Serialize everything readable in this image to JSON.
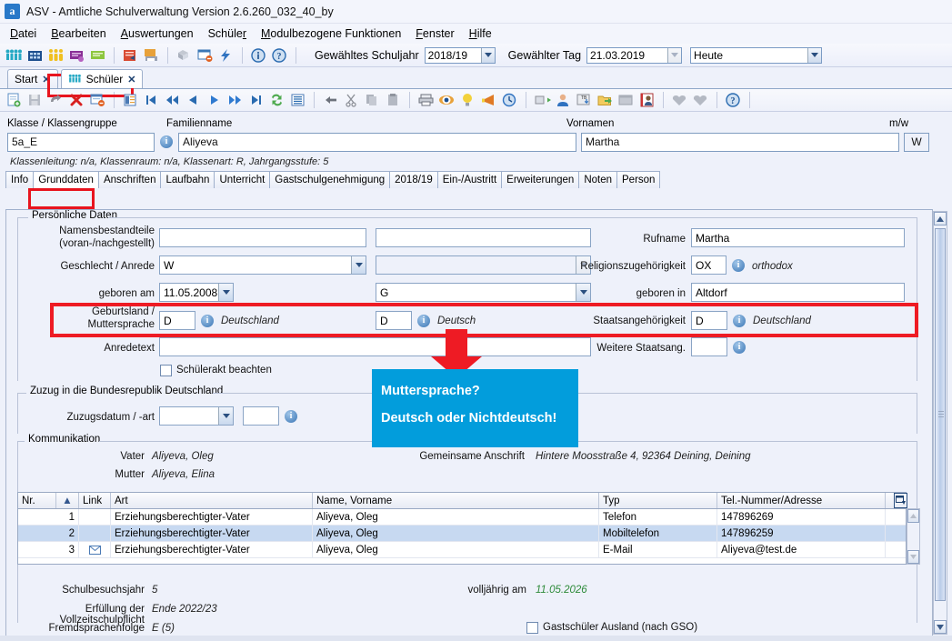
{
  "window": {
    "title": "ASV - Amtliche Schulverwaltung Version 2.6.260_032_40_by",
    "app_icon": "a"
  },
  "menubar": {
    "items": [
      {
        "label": "Datei",
        "mnemonic": "D"
      },
      {
        "label": "Bearbeiten",
        "mnemonic": "B"
      },
      {
        "label": "Auswertungen",
        "mnemonic": "A"
      },
      {
        "label": "Schüler",
        "mnemonic": "r"
      },
      {
        "label": "Modulbezogene Funktionen",
        "mnemonic": "M"
      },
      {
        "label": "Fenster",
        "mnemonic": "F"
      },
      {
        "label": "Hilfe",
        "mnemonic": "H"
      }
    ]
  },
  "toolbar_main": {
    "icons": [
      "students-group-icon",
      "school-building-icon",
      "persons-icon",
      "purple-card-icon",
      "green-card-icon",
      "report-book-icon",
      "print-list-icon",
      "module-grey-icon",
      "window-block-icon",
      "lightning-icon",
      "info-icon",
      "help-icon"
    ],
    "schoolyear_label": "Gewähltes Schuljahr",
    "schoolyear_value": "2018/19",
    "day_label": "Gewählter Tag",
    "day_value": "21.03.2019",
    "today_value": "Heute"
  },
  "window_tabs": [
    {
      "label": "Start",
      "icon": "",
      "active": false,
      "closable": true
    },
    {
      "label": "Schüler",
      "icon": "students-group-icon",
      "active": true,
      "closable": true,
      "highlighted": true
    }
  ],
  "toolbar_edit": {
    "icons": [
      "new-document-icon",
      "save-icon",
      "undo-icon",
      "delete-red-x-icon",
      "form-remove-icon",
      "list-view-icon",
      "first-record-icon",
      "prev-page-icon",
      "prev-record-icon",
      "next-record-icon",
      "next-page-icon",
      "last-record-icon",
      "refresh-icon",
      "report-icon",
      "back-arrow-icon",
      "cut-icon",
      "copy-icon",
      "paste-icon",
      "print-icon",
      "preview-eye-icon",
      "bulb-icon",
      "trumpet-icon",
      "clock-icon",
      "export-box-icon",
      "person-blue-icon",
      "tb-table-icon",
      "folder-export-icon",
      "grey-window-icon",
      "photo-person-icon",
      "grey-heart-left-icon",
      "grey-heart-right-icon",
      "help-blue-icon"
    ]
  },
  "header": {
    "klasse_label": "Klasse / Klassengruppe",
    "klasse_value": "5a_E",
    "familienname_label": "Familienname",
    "familienname_value": "Aliyeva",
    "vornamen_label": "Vornamen",
    "vornamen_value": "Martha",
    "mw_label": "m/w",
    "mw_value": "W",
    "info_line": "Klassenleitung: n/a, Klassenraum: n/a, Klassenart: R, Jahrgangsstufe: 5"
  },
  "content_tabs": [
    {
      "label": "Info",
      "active": false
    },
    {
      "label": "Grunddaten",
      "active": true,
      "highlighted": true
    },
    {
      "label": "Anschriften",
      "active": false
    },
    {
      "label": "Laufbahn",
      "active": false
    },
    {
      "label": "Unterricht",
      "active": false
    },
    {
      "label": "Gastschulgenehmigung",
      "active": false
    },
    {
      "label": "2018/19",
      "active": false
    },
    {
      "label": "Ein-/Austritt",
      "active": false
    },
    {
      "label": "Erweiterungen",
      "active": false
    },
    {
      "label": "Noten",
      "active": false
    },
    {
      "label": "Person",
      "active": false
    }
  ],
  "personal_group": {
    "title": "Persönliche Daten",
    "namensbestandteile_label": "Namensbestandteile\n(voran-/nachgestellt)",
    "namensbestandteile_label_1": "Namensbestandteile",
    "namensbestandteile_label_2": "(voran-/nachgestellt)",
    "namensbestandteile_value_1": "",
    "namensbestandteile_value_2": "",
    "geschlecht_label": "Geschlecht / Anrede",
    "geschlecht_value": "W",
    "anrede_value": "",
    "geboren_am_label": "geboren am",
    "geboren_am_value": "11.05.2008",
    "geburtsart_value": "G",
    "geburtsland_label_1": "Geburtsland /",
    "geburtsland_label_2": "Muttersprache",
    "geburtsland_value": "D",
    "geburtsland_text": "Deutschland",
    "muttersprache_value": "D",
    "muttersprache_text": "Deutsch",
    "anredetext_label": "Anredetext",
    "anredetext_value": "",
    "schuelerakt_label": "Schülerakt beachten",
    "rufname_label": "Rufname",
    "rufname_value": "Martha",
    "religion_label": "Religionszugehörigkeit",
    "religion_value": "OX",
    "religion_text": "orthodox",
    "geboren_in_label": "geboren in",
    "geboren_in_value": "Altdorf",
    "staatsang_label": "Staatsangehörigkeit",
    "staatsang_value": "D",
    "staatsang_text": "Deutschland",
    "weitere_staatsang_label": "Weitere Staatsang.",
    "weitere_staatsang_value": ""
  },
  "zuzug_group": {
    "title": "Zuzug in die Bundesrepublik Deutschland",
    "zuzugsdatum_label": "Zuzugsdatum / -art",
    "zuzugsdatum_value": "",
    "zuzugsart_value": ""
  },
  "kommunikation_group": {
    "title": "Kommunikation",
    "vater_label": "Vater",
    "vater_value": "Aliyeva, Oleg",
    "mutter_label": "Mutter",
    "mutter_value": "Aliyeva, Elina",
    "anschrift_label": "Gemeinsame Anschrift",
    "anschrift_value": "Hintere Moosstraße 4, 92364 Deining, Deining"
  },
  "contacts_table": {
    "columns": [
      "Nr.",
      "Link",
      "Art",
      "Name, Vorname",
      "Typ",
      "Tel.-Nummer/Adresse"
    ],
    "sort_indicator": "▲",
    "rows": [
      {
        "nr": "1",
        "link": "",
        "art": "Erziehungsberechtigter-Vater",
        "name": "Aliyeva, Oleg",
        "typ": "Telefon",
        "tel": "147896269",
        "selected": false
      },
      {
        "nr": "2",
        "link": "",
        "art": "Erziehungsberechtigter-Vater",
        "name": "Aliyeva, Oleg",
        "typ": "Mobiltelefon",
        "tel": "147896259",
        "selected": true
      },
      {
        "nr": "3",
        "link": "mail-icon",
        "art": "Erziehungsberechtigter-Vater",
        "name": "Aliyeva, Oleg",
        "typ": "E-Mail",
        "tel": "Aliyeva@test.de",
        "selected": false
      }
    ],
    "column_chooser_icon": "column-settings-icon"
  },
  "footer": {
    "schulbesuchsjahr_label": "Schulbesuchsjahr",
    "schulbesuchsjahr_value": "5",
    "volljaehrig_label": "volljährig am",
    "volljaehrig_value": "11.05.2026",
    "vollzeit_label": "Erfüllung der Vollzeitschulpflicht",
    "vollzeit_value": "Ende 2022/23",
    "fremdsprachen_label": "Fremdsprachenfolge",
    "fremdsprachen_value": "E (5)",
    "gastschueler_label": "Gastschüler Ausland (nach GSO)"
  },
  "annotation": {
    "line1": "Muttersprache?",
    "line2": "Deutsch oder Nichtdeutsch!",
    "bg_color": "#029ddc",
    "arrow_color": "#ee1b24",
    "highlight_color": "#ee1b24"
  }
}
